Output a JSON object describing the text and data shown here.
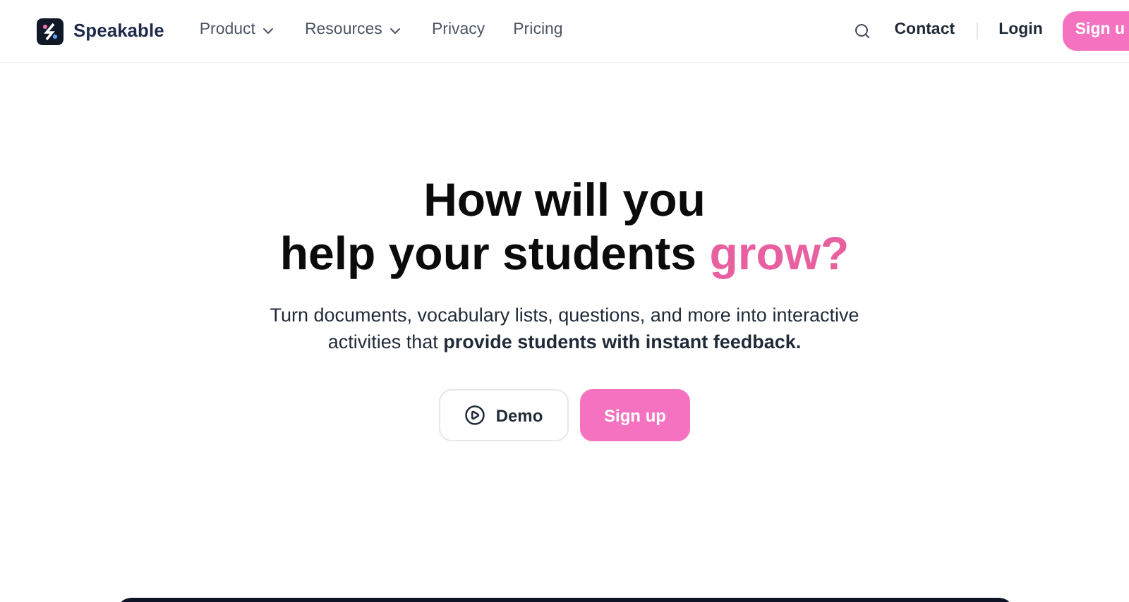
{
  "nav": {
    "brand": "Speakable",
    "links": [
      {
        "label": "Product",
        "dropdown": true
      },
      {
        "label": "Resources",
        "dropdown": true
      },
      {
        "label": "Privacy",
        "dropdown": false
      },
      {
        "label": "Pricing",
        "dropdown": false
      }
    ],
    "contact": "Contact",
    "login": "Login",
    "signup": "Sign u"
  },
  "hero": {
    "headline_line1": "How will you",
    "headline_line2": "help your students",
    "headline_highlight": "grow?",
    "subtitle": "Turn documents, vocabulary lists, questions, and more into interactive activities that **provide students with instant feedback.**",
    "demo_button": "Demo",
    "signup_button": "Sign up"
  }
}
